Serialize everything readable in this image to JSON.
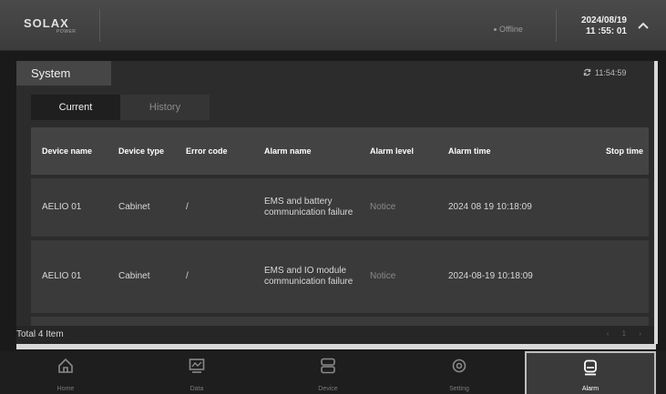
{
  "header": {
    "logo_text": "SOLAX",
    "logo_sub": "POWER",
    "status": "Offline",
    "date": "2024/08/19",
    "time": "11 :55: 01"
  },
  "panel": {
    "tab_label": "System",
    "refresh_time": "11:54:59",
    "subtabs": [
      "Current",
      "History"
    ]
  },
  "table": {
    "headers": [
      "Device name",
      "Device type",
      "Error code",
      "Alarm name",
      "Alarm level",
      "Alarm time",
      "Stop time"
    ],
    "rows": [
      {
        "device": "AELIO 01",
        "type": "Cabinet",
        "code": "/",
        "alarm": "EMS and battery communication failure",
        "level": "Notice",
        "time": "2024 08 19 10:18:09",
        "stop": ""
      },
      {
        "device": "AELIO 01",
        "type": "Cabinet",
        "code": "/",
        "alarm": "EMS and IO module communication failure",
        "level": "Notice",
        "time": "2024-08-19 10:18:09",
        "stop": ""
      }
    ]
  },
  "footer": {
    "total": "Total 4 Item",
    "page": "1"
  },
  "nav": {
    "items": [
      {
        "label": "Home",
        "icon": "home-icon"
      },
      {
        "label": "Data",
        "icon": "chart-icon"
      },
      {
        "label": "Device",
        "icon": "server-icon"
      },
      {
        "label": "Setting",
        "icon": "gear-icon"
      },
      {
        "label": "Alarm",
        "icon": "alarm-icon"
      }
    ]
  },
  "colors": {
    "header": "#444444",
    "panel": "#2c2c2c",
    "row": "#3a3a3a",
    "active_nav": "#3a3a3a"
  }
}
